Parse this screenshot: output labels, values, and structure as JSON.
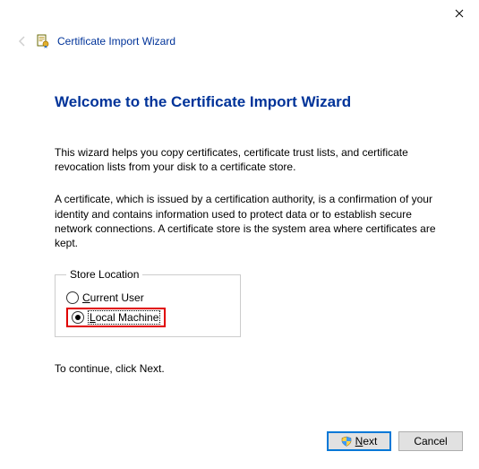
{
  "wizard_name": "Certificate Import Wizard",
  "title": "Welcome to the Certificate Import Wizard",
  "desc1": "This wizard helps you copy certificates, certificate trust lists, and certificate revocation lists from your disk to a certificate store.",
  "desc2": "A certificate, which is issued by a certification authority, is a confirmation of your identity and contains information used to protect data or to establish secure network connections. A certificate store is the system area where certificates are kept.",
  "store_location": {
    "legend": "Store Location",
    "options": [
      {
        "label": "Current User",
        "mnemonic": "C",
        "checked": false
      },
      {
        "label": "Local Machine",
        "mnemonic": "L",
        "checked": true
      }
    ]
  },
  "continue_msg": "To continue, click Next.",
  "buttons": {
    "next": "Next",
    "next_mnemonic": "N",
    "cancel": "Cancel"
  },
  "icons": {
    "close": "close-icon",
    "back": "back-arrow-icon",
    "wizard": "certificate-wizard-icon",
    "shield": "uac-shield-icon"
  }
}
